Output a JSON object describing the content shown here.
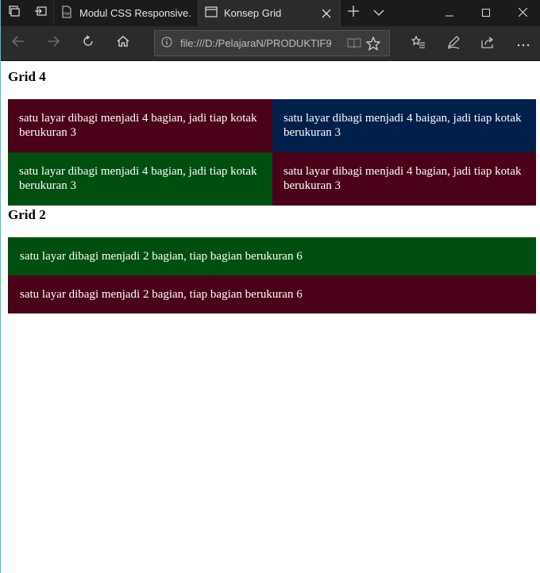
{
  "browser": {
    "tabs": [
      {
        "label": "Modul CSS Responsive.p",
        "icon": "pdf-icon",
        "active": false
      },
      {
        "label": "Konsep Grid",
        "icon": "page-icon",
        "active": true
      }
    ],
    "address": "file:///D:/PelajaraN/PRODUKTIF9"
  },
  "page": {
    "grid4_heading": "Grid 4",
    "grid4_cells": [
      {
        "text": "satu layar dibagi menjadi 4 bagian, jadi tiap kotak berukuran 3",
        "color": "#4a0019"
      },
      {
        "text": "satu layar dibagi menjadi 4 baigan, jadi tiap kotak berukuran 3",
        "color": "#00204c"
      },
      {
        "text": "satu layar dibagi menjadi 4 bagian, jadi tiap kotak berukuran 3",
        "color": "#004f0e"
      },
      {
        "text": "satu layar dibagi menjadi 4 bagian, jadi tiap kotak berukuran 3",
        "color": "#4a0019"
      }
    ],
    "grid2_heading": "Grid 2",
    "grid2_cells": [
      {
        "text": "satu layar dibagi menjadi 2 bagian, tiap bagian berukuran 6",
        "color": "#004f0e"
      },
      {
        "text": "satu layar dibagi menjadi 2 bagian, tiap bagian berukuran 6",
        "color": "#4a0019"
      }
    ]
  }
}
